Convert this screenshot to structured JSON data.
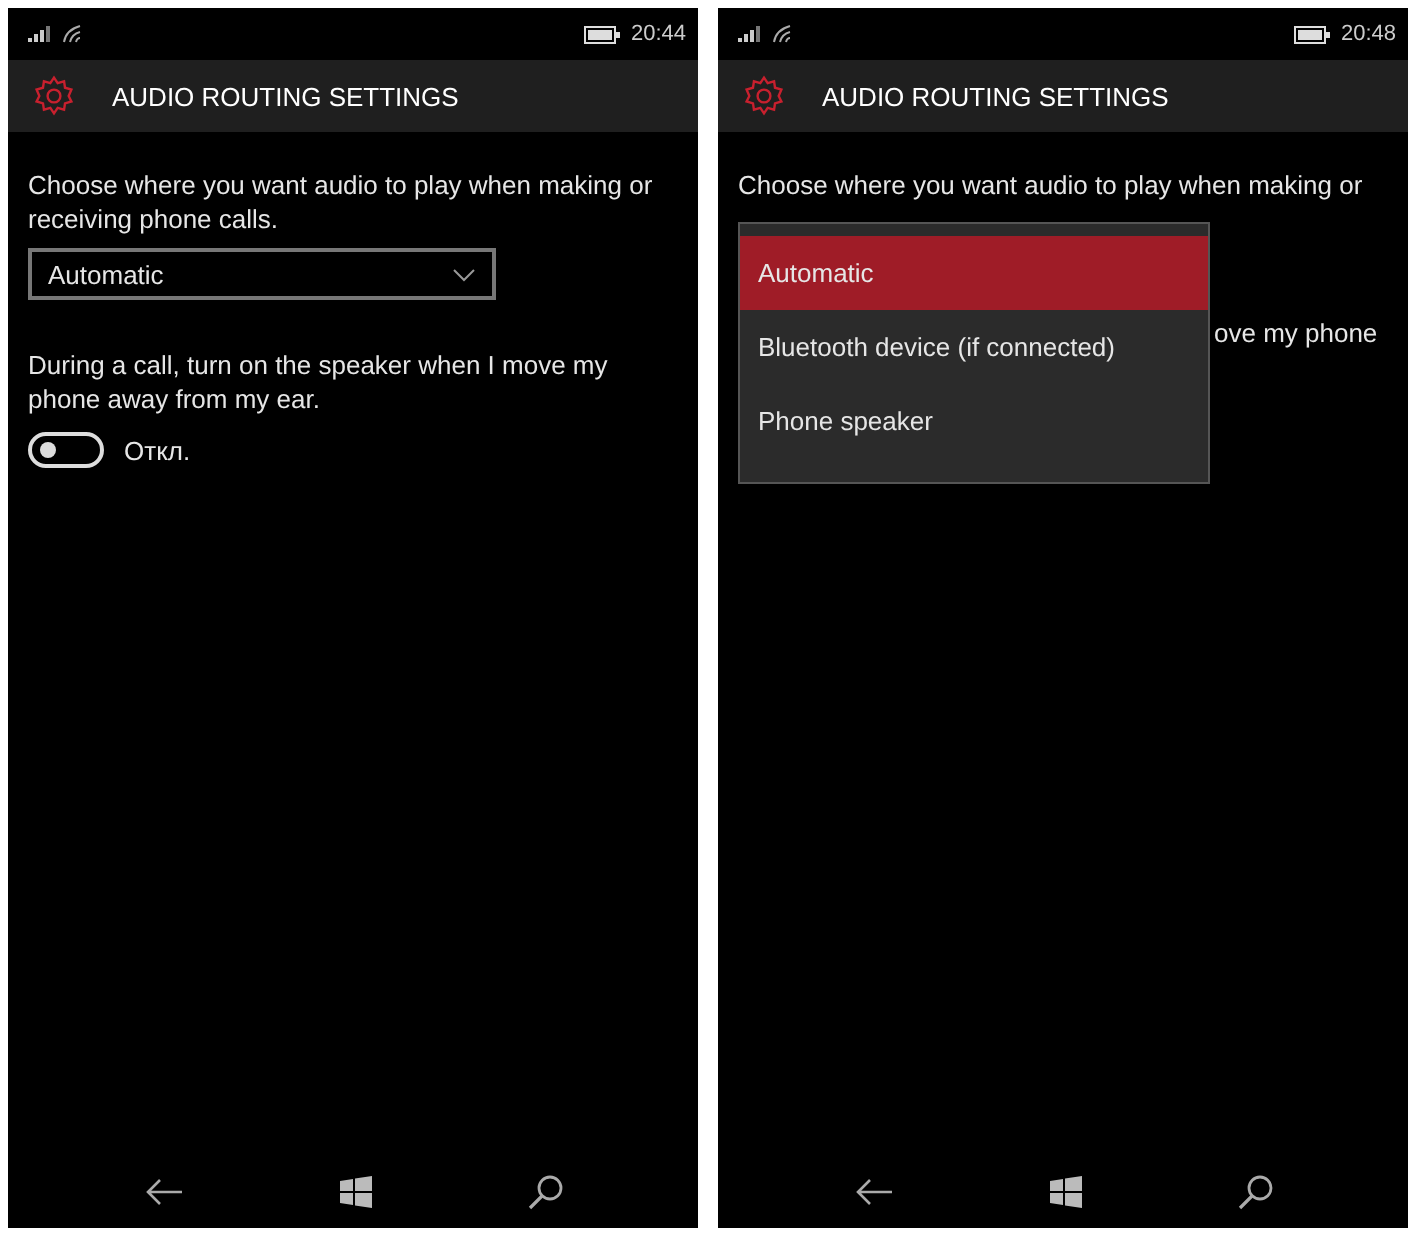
{
  "screens": [
    {
      "kind": "settings",
      "status_bar": {
        "time": "20:44"
      },
      "header": {
        "title": "AUDIO ROUTING SETTINGS"
      },
      "description": "Choose where you want audio to play when making or receiving phone calls.",
      "dropdown": {
        "value": "Automatic"
      },
      "speaker_option": {
        "label": "During a call, turn on the speaker when I move my phone away from my ear."
      },
      "toggle": {
        "on": false,
        "label": "Откл."
      }
    },
    {
      "kind": "menu_open",
      "status_bar": {
        "time": "20:48"
      },
      "header": {
        "title": "AUDIO ROUTING SETTINGS"
      },
      "description": "Choose where you want audio to play when making or",
      "speaker_option": {
        "label": "ove my phone"
      },
      "dropdown_menu": {
        "options": [
          {
            "label": "Automatic",
            "selected": true
          },
          {
            "label": "Bluetooth device (if connected)",
            "selected": false
          },
          {
            "label": "Phone speaker",
            "selected": false
          }
        ]
      }
    }
  ]
}
